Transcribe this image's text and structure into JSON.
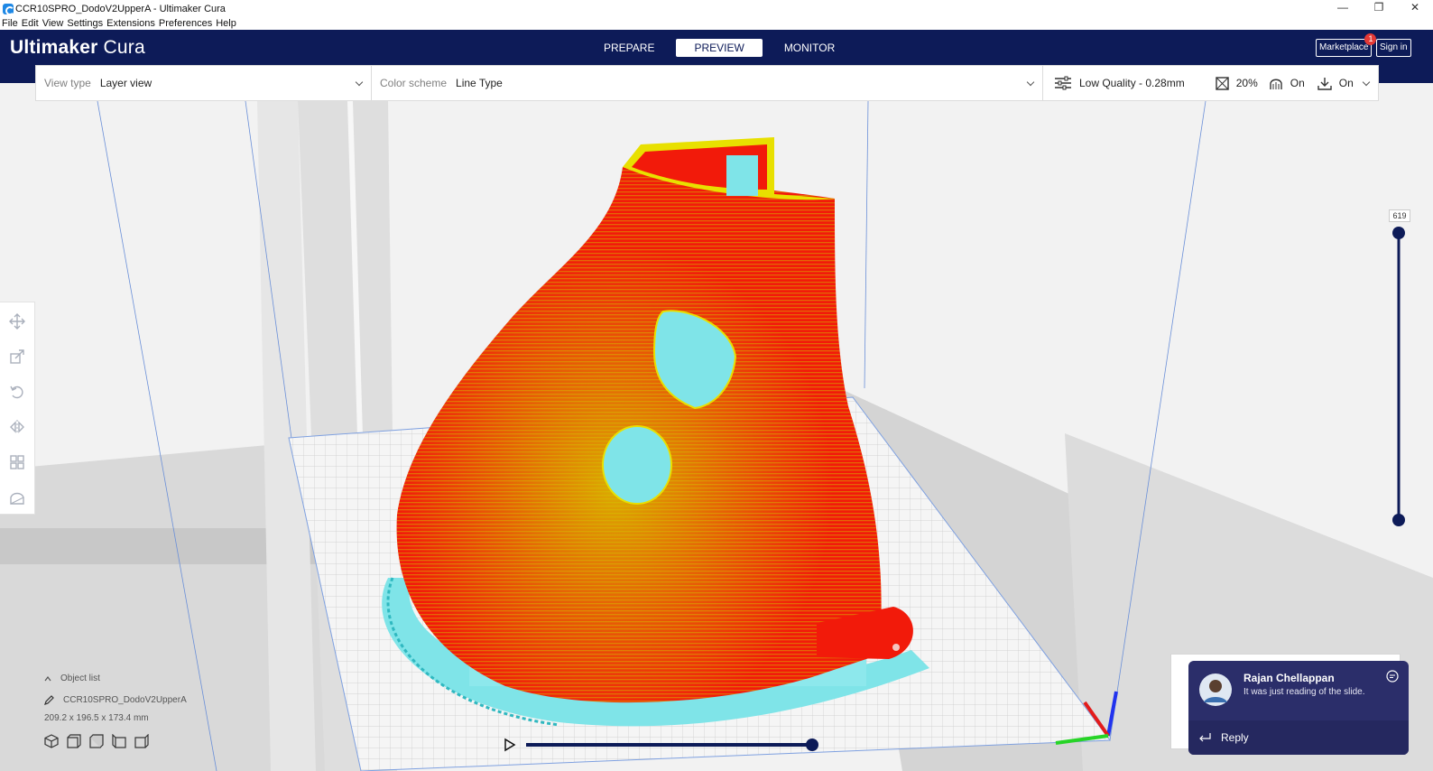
{
  "window": {
    "title": "CCR10SPRO_DodoV2UpperA - Ultimaker Cura",
    "minimize": "—",
    "maximize": "❐",
    "close": "✕"
  },
  "menu": [
    "File",
    "Edit",
    "View",
    "Settings",
    "Extensions",
    "Preferences",
    "Help"
  ],
  "header": {
    "logo_bold": "Ultimaker",
    "logo_light": " Cura",
    "tabs": [
      "PREPARE",
      "PREVIEW",
      "MONITOR"
    ],
    "active_tab": "PREVIEW",
    "marketplace": "Marketplace",
    "marketplace_badge": "1",
    "sign_in": "Sign in"
  },
  "toolbar": {
    "view_type_label": "View type",
    "view_type_value": "Layer view",
    "color_scheme_label": "Color scheme",
    "color_scheme_value": "Line Type",
    "profile": "Low Quality - 0.28mm",
    "infill": "20%",
    "support": "On",
    "adhesion": "On"
  },
  "object_list": {
    "header": "Object list",
    "object_name": "CCR10SPRO_DodoV2UpperA",
    "dimensions": "209.2 x 196.5 x 173.4 mm"
  },
  "layer_slider": {
    "current_layer": "619"
  },
  "notification": {
    "sender": "Rajan Chellappan",
    "message": "It was just reading of the slide.",
    "reply_label": "Reply"
  },
  "colors": {
    "header_bg": "#0d1b58",
    "model_red": "#f21a0a",
    "model_yellow": "#e8e000",
    "support_cyan": "#7fe4e8"
  }
}
